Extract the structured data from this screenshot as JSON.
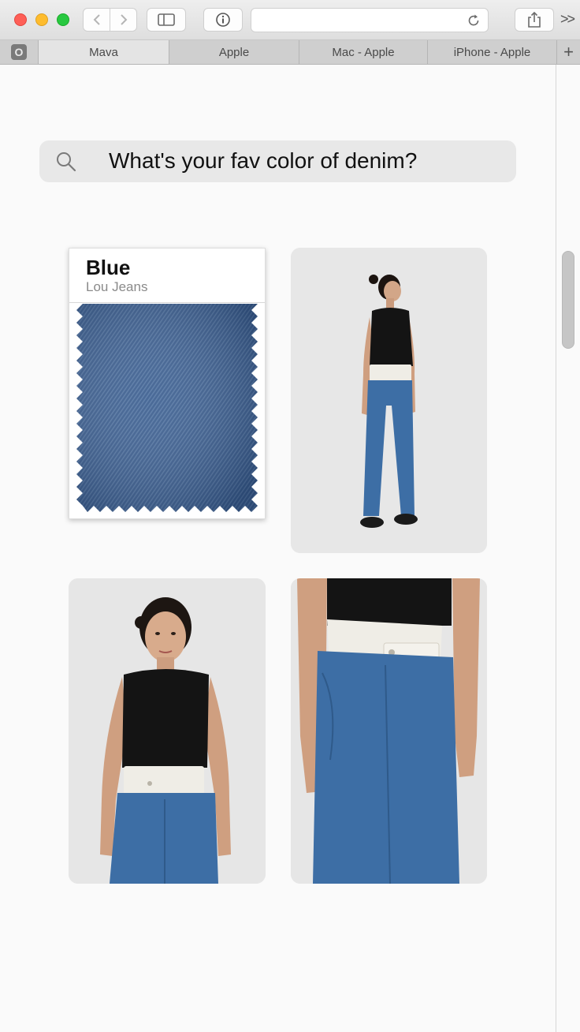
{
  "browser": {
    "tabs": [
      "Mava",
      "Apple",
      "Mac - Apple",
      "iPhone - Apple"
    ],
    "active_tab": 0,
    "pinned_tab_letter": "O",
    "overflow_label": ">>",
    "new_tab_label": "+"
  },
  "search": {
    "query": "What's your fav color of denim?"
  },
  "swatch": {
    "title": "Blue",
    "brand": "Lou Jeans",
    "color": "#3a5d8f"
  },
  "colors": {
    "close": "#fe5f57",
    "minimize": "#febc2e",
    "zoom": "#28c840",
    "denim": "#3d6ea5",
    "top": "#141414",
    "belt": "#efede6"
  }
}
